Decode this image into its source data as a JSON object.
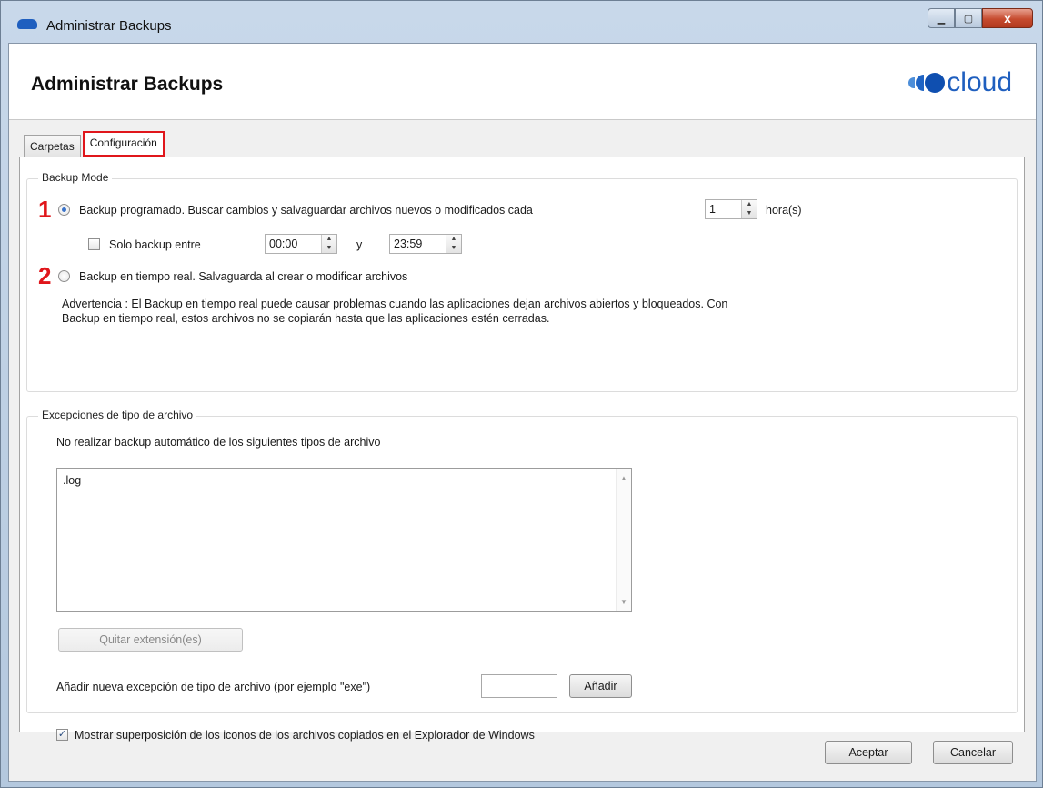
{
  "window": {
    "title": "Administrar Backups",
    "minimize": "▁",
    "maximize": "▢",
    "close": "x"
  },
  "header": {
    "title": "Administrar Backups",
    "logo_text": "cloud"
  },
  "tabs": [
    {
      "label": "Carpetas"
    },
    {
      "label": "Configuración"
    }
  ],
  "backup_mode": {
    "title": "Backup Mode",
    "marker1": "1",
    "marker2": "2",
    "scheduled_label": "Backup programado. Buscar cambios y salvaguardar archivos nuevos o modificados cada",
    "scheduled_selected": true,
    "interval_value": "1",
    "interval_unit": "hora(s)",
    "only_between_label": "Solo backup entre",
    "only_between_checked": false,
    "start_time": "00:00",
    "and_label": "y",
    "end_time": "23:59",
    "realtime_label": "Backup en tiempo real. Salvaguarda al crear o modificar archivos",
    "realtime_selected": false,
    "warning_line1": "Advertencia : El Backup en tiempo real puede causar problemas cuando las aplicaciones dejan archivos abiertos y bloqueados. Con",
    "warning_line2": "Backup en tiempo real, estos archivos no se copiarán hasta que las aplicaciones estén cerradas."
  },
  "exceptions": {
    "title": "Excepciones de tipo de archivo",
    "description": "No realizar backup automático de los siguientes tipos de archivo",
    "items": [
      ".log"
    ],
    "remove_button": "Quitar extensión(es)",
    "add_label": "Añadir nueva excepción de tipo de archivo (por ejemplo \"exe\")",
    "add_input_value": "",
    "add_button": "Añadir"
  },
  "overlay": {
    "label": "Mostrar superposición de los iconos de los archivos copiados en el Explorador de Windows",
    "checked": true,
    "check_glyph": "✓"
  },
  "footer": {
    "ok": "Aceptar",
    "cancel": "Cancelar"
  }
}
